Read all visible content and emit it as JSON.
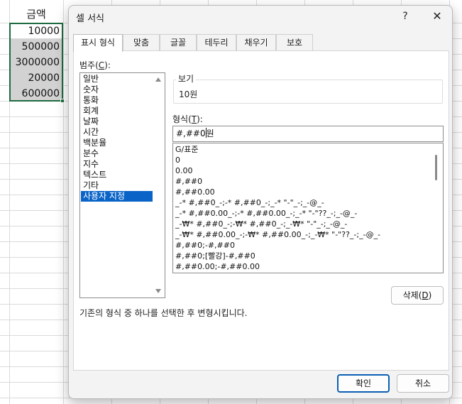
{
  "spreadsheet": {
    "header": "금액",
    "cells": [
      "10000",
      "500000",
      "3000000",
      "20000",
      "600000"
    ]
  },
  "dialog": {
    "title": "셀 서식",
    "help": "?",
    "close": "✕",
    "tabs": [
      "표시 형식",
      "맞춤",
      "글꼴",
      "테두리",
      "채우기",
      "보호"
    ],
    "category_label_pre": "범주(",
    "category_label_key": "C",
    "category_label_post": "):",
    "categories": [
      "일반",
      "숫자",
      "통화",
      "회계",
      "날짜",
      "시간",
      "백분율",
      "분수",
      "지수",
      "텍스트",
      "기타",
      "사용자 지정"
    ],
    "selected_category": "사용자 지정",
    "sample_label": "보기",
    "sample_value": "10원",
    "type_label_pre": "형식(",
    "type_label_key": "T",
    "type_label_post": "):",
    "type_value": "#,##0",
    "type_value_after": "원",
    "format_codes": [
      "G/표준",
      "0",
      "0.00",
      "#,##0",
      "#,##0.00",
      "_-* #,##0_-;-* #,##0_-;_-* \"-\"_-;_-@_-",
      "_-* #,##0.00_-;-* #,##0.00_-;_-* \"-\"??_-;_-@_-",
      "_-₩* #,##0_-;-₩* #,##0_-;_-₩* \"-\"_-;_-@_-",
      "_-₩* #,##0.00_-;-₩* #,##0.00_-;_-₩* \"-\"??_-;_-@_-",
      "#,##0;-#,##0",
      "#,##0;[빨강]-#,##0",
      "#,##0.00;-#,##0.00"
    ],
    "delete_label_pre": "삭제(",
    "delete_label_key": "D",
    "delete_label_post": ")",
    "description": "기존의 형식 중 하나를 선택한 후 변형시킵니다.",
    "ok_label": "확인",
    "cancel_label": "취소"
  },
  "colors": {
    "selection_accent": "#0a64c8",
    "excel_green": "#1e6b41"
  }
}
